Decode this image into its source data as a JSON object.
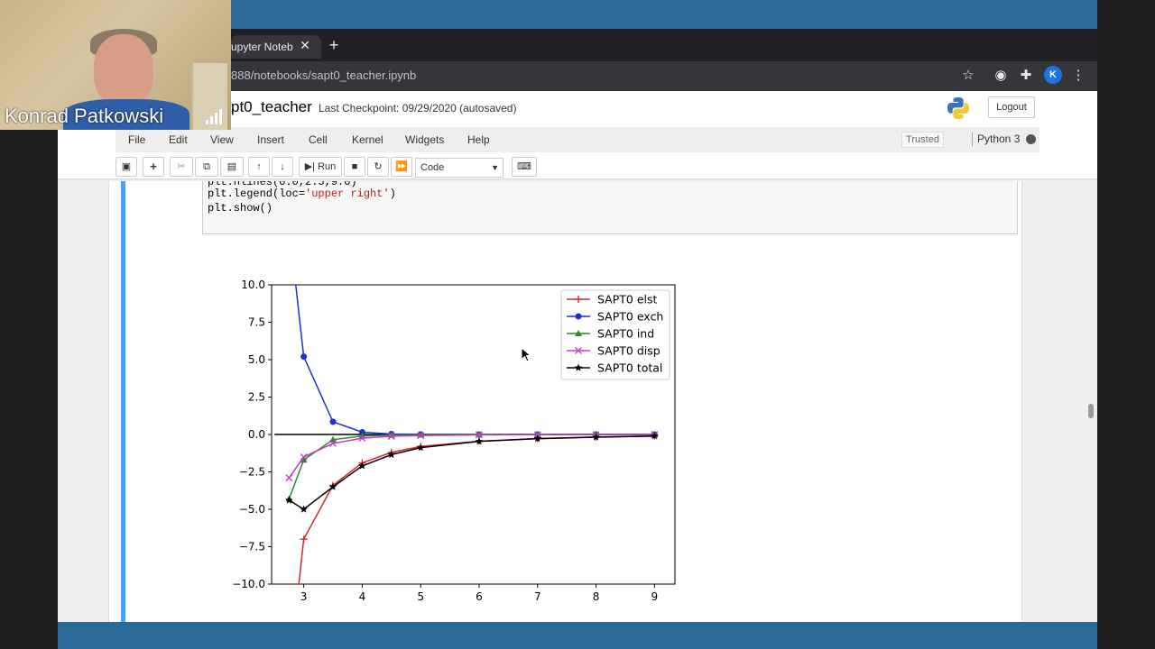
{
  "webcam": {
    "name": "Konrad Patkowski"
  },
  "browser": {
    "tab_title": "upyter Noteb",
    "tab_close": "✕",
    "new_tab": "+",
    "url": "888/notebooks/sapt0_teacher.ipynb",
    "profile_initial": "K"
  },
  "jupyter": {
    "title": "pt0_teacher",
    "checkpoint": "Last Checkpoint: 09/29/2020   (autosaved)",
    "logout": "Logout",
    "menu": [
      "File",
      "Edit",
      "View",
      "Insert",
      "Cell",
      "Kernel",
      "Widgets",
      "Help"
    ],
    "trusted": "Trusted",
    "kernel": "Python 3",
    "run_label": "Run",
    "cell_type": "Code"
  },
  "code": {
    "line1_partial": "plt.hlines(0.0,2.5,9.0)",
    "line2_prefix": "plt.legend(loc=",
    "line2_string": "'upper right'",
    "line2_suffix": ")",
    "line3": "plt.show()"
  },
  "chart_data": {
    "type": "line",
    "xlim": [
      2.45,
      9.35
    ],
    "ylim": [
      -10.0,
      10.0
    ],
    "xticks": [
      "3",
      "4",
      "5",
      "6",
      "7",
      "8",
      "9"
    ],
    "yticks": [
      "10.0",
      "7.5",
      "5.0",
      "2.5",
      "0.0",
      "−2.5",
      "−5.0",
      "−7.5",
      "−10.0"
    ],
    "legend_position": "upper right",
    "hline": {
      "y": 0.0,
      "xmin": 2.5,
      "xmax": 9.0
    },
    "x": [
      2.75,
      3.0,
      3.5,
      4.0,
      4.5,
      5.0,
      6.0,
      7.0,
      8.0,
      9.0
    ],
    "series": [
      {
        "name": "SAPT0 elst",
        "color": "#d62728",
        "marker": "plus",
        "values": [
          -16.0,
          -7.0,
          -3.4,
          -1.9,
          -1.2,
          -0.8,
          -0.45,
          -0.28,
          -0.17,
          -0.1
        ]
      },
      {
        "name": "SAPT0 exch",
        "color": "#1f2fd6",
        "marker": "circle",
        "values": [
          14.0,
          5.2,
          0.85,
          0.15,
          0.03,
          0.01,
          0.0,
          0.0,
          0.0,
          0.0
        ]
      },
      {
        "name": "SAPT0 ind",
        "color": "#2a8a2a",
        "marker": "triangle",
        "values": [
          -4.3,
          -1.7,
          -0.35,
          -0.1,
          -0.04,
          -0.02,
          0.0,
          0.0,
          0.0,
          0.0
        ]
      },
      {
        "name": "SAPT0 disp",
        "color": "#c040c0",
        "marker": "x",
        "values": [
          -2.9,
          -1.5,
          -0.6,
          -0.25,
          -0.12,
          -0.07,
          -0.03,
          -0.01,
          -0.01,
          0.0
        ]
      },
      {
        "name": "SAPT0 total",
        "color": "#000000",
        "marker": "star",
        "values": [
          -4.4,
          -5.0,
          -3.5,
          -2.1,
          -1.35,
          -0.88,
          -0.46,
          -0.28,
          -0.18,
          -0.1
        ]
      }
    ]
  }
}
